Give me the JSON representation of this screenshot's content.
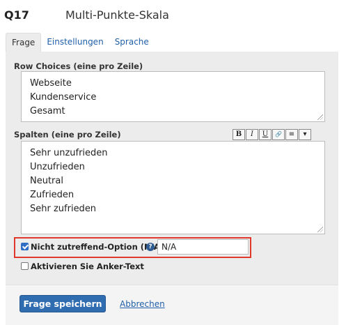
{
  "question": {
    "number": "Q17",
    "type": "Multi-Punkte-Skala"
  },
  "tabs": [
    {
      "label": "Frage",
      "active": true
    },
    {
      "label": "Einstellungen",
      "active": false
    },
    {
      "label": "Sprache",
      "active": false
    }
  ],
  "row_choices": {
    "label": "Row Choices (eine pro Zeile)",
    "lines": [
      "Webseite",
      "Kundenservice",
      "Gesamt"
    ]
  },
  "columns": {
    "label": "Spalten (eine pro Zeile)",
    "toolbar": [
      {
        "name": "bold-button",
        "glyph": "B"
      },
      {
        "name": "italic-button",
        "glyph": "I"
      },
      {
        "name": "underline-button",
        "glyph": "U"
      },
      {
        "name": "link-button",
        "glyph": "🔗"
      },
      {
        "name": "strikethrough-button",
        "glyph": "≡"
      },
      {
        "name": "dropdown-button",
        "glyph": "▾"
      }
    ],
    "lines": [
      "Sehr unzufrieden",
      "Unzufrieden",
      "Neutral",
      "Zufrieden",
      "Sehr zufrieden"
    ]
  },
  "na_option": {
    "label": "Nicht zutreffend-Option (N/A)",
    "checked": true,
    "value": "N/A"
  },
  "anchor_text": {
    "label": "Aktivieren Sie Anker-Text",
    "checked": false
  },
  "footer": {
    "save_label": "Frage speichern",
    "cancel_label": "Abbrechen"
  },
  "colors": {
    "accent": "#2f6db0",
    "highlight_border": "#e0382b",
    "link": "#1f5fa8"
  }
}
